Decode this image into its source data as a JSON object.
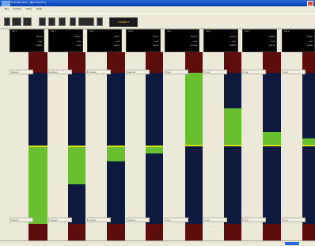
{
  "window": {
    "title": "CLR-STR Main - [Bar Monitor]"
  },
  "menu": [
    "File",
    "Control",
    "View",
    "Help"
  ],
  "toolbar": {
    "connect_label": "CONNECT"
  },
  "channels": [
    {
      "name": "CH1_1",
      "cur": "2902.0",
      "min": "0.00",
      "max": "2002.0",
      "top": "10000.00",
      "bottom": "10000.00"
    },
    {
      "name": "CH1_2",
      "cur": "-588.97",
      "min": "0.00",
      "max": "22.55",
      "top": "10000.00",
      "bottom": "10000.00"
    },
    {
      "name": "CH1_3",
      "cur": "2161.5",
      "min": "0.00",
      "max": "2161.5",
      "top": "10000.00",
      "bottom": "10000.00"
    },
    {
      "name": "CH1_4",
      "cur": "257.26",
      "min": "0.00",
      "max": "257.26",
      "top": "10000.00",
      "bottom": "10000.00"
    },
    {
      "name": "CH2_1",
      "cur": "0.01130",
      "min": "0.01",
      "max": "0.01124",
      "top": "10.00",
      "bottom": "10.00"
    },
    {
      "name": "CH2_2",
      "cur": "1.37793",
      "min": "0.01",
      "max": "1.35193",
      "top": "10.00",
      "bottom": "10.00"
    },
    {
      "name": "CH2_3",
      "cur": "1.39484",
      "min": "0.01",
      "max": "1.39173",
      "top": "10.00",
      "bottom": "10.00"
    },
    {
      "name": "CH2_4",
      "cur": "0.5930",
      "min": "0.01",
      "max": "0.5930",
      "top": "10.00",
      "bottom": "10.00"
    }
  ]
}
